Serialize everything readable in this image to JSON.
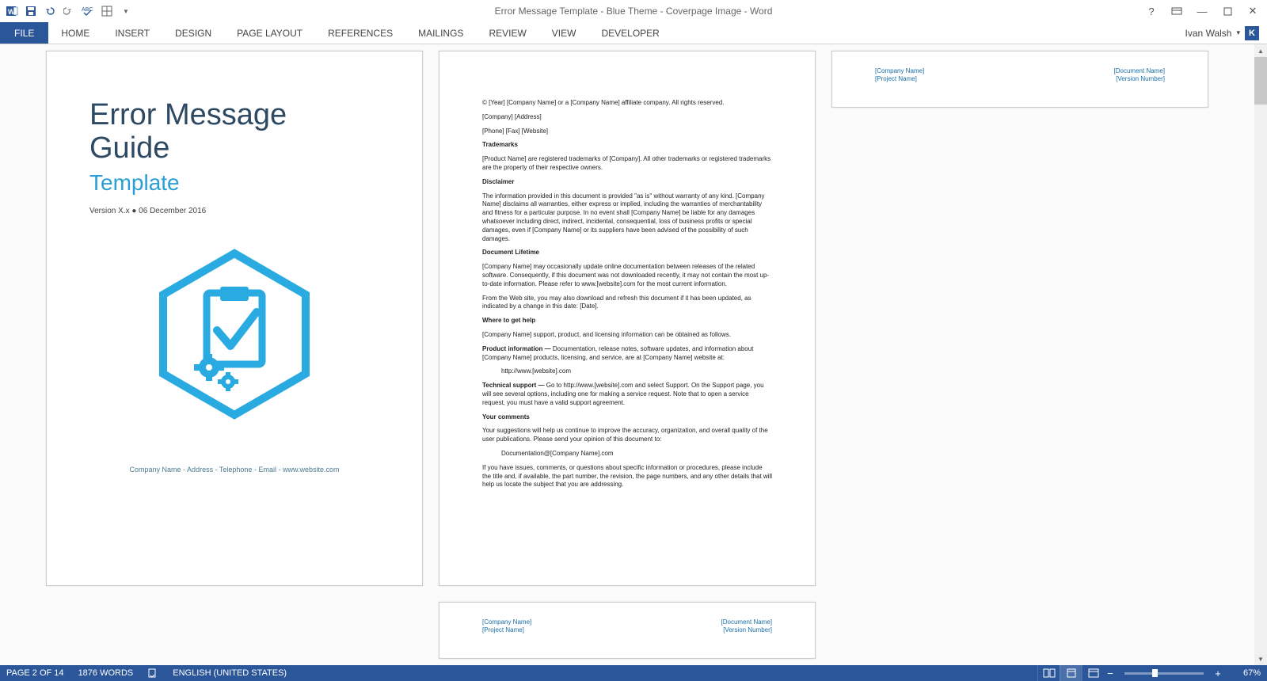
{
  "window": {
    "title": "Error Message Template - Blue Theme - Coverpage Image - Word"
  },
  "user": {
    "name": "Ivan Walsh",
    "dropdown": "▾",
    "badge": "K"
  },
  "ribbon": {
    "file": "FILE",
    "tabs": [
      "HOME",
      "INSERT",
      "DESIGN",
      "PAGE LAYOUT",
      "REFERENCES",
      "MAILINGS",
      "REVIEW",
      "VIEW",
      "DEVELOPER"
    ]
  },
  "cover": {
    "title1": "Error Message",
    "title2": "Guide",
    "subtitle": "Template",
    "version": "Version X.x ● 06 December 2016",
    "footer": "Company Name - Address - Telephone - Email - www.website.com"
  },
  "legal": {
    "copyright": "© [Year] [Company Name] or a [Company Name] affiliate company. All rights reserved.",
    "company_addr": "[Company] [Address]",
    "phone_line": "[Phone] [Fax] [Website]",
    "trademarks_h": "Trademarks",
    "trademarks": "[Product Name] are registered trademarks of [Company]. All other trademarks or registered trademarks are the property of their respective owners.",
    "disclaimer_h": "Disclaimer",
    "disclaimer": "The information provided in this document is provided \"as is\" without warranty of any kind. [Company Name] disclaims all warranties, either express or implied, including the warranties of merchantability and fitness for a particular purpose. In no event shall [Company Name] be liable for any damages whatsoever including direct, indirect, incidental, consequential, loss of business profits or special damages, even if [Company Name] or its suppliers have been advised of the possibility of such damages.",
    "lifetime_h": "Document Lifetime",
    "lifetime1": "[Company Name] may occasionally update online documentation between releases of the related software. Consequently, if this document was not downloaded recently, it may not contain the most up-to-date information. Please refer to www.[website].com for the most current information.",
    "lifetime2": "From the Web site, you may also download and refresh this document if it has been updated, as indicated by a change in this date: [Date].",
    "help_h": "Where to get help",
    "help": "[Company Name] support, product, and licensing information can be obtained as follows.",
    "prodinfo_label": "Product information —",
    "prodinfo": " Documentation, release notes, software updates, and information about [Company Name] products, licensing, and service, are at [Company Name] website at:",
    "prodinfo_url": "http://www.[website].com",
    "tech_label": "Technical support —",
    "tech": " Go to http://www.[website].com and select Support. On the Support page, you will see several options, including one for making a service request. Note that to open a service request, you must have a valid support agreement.",
    "comments_h": "Your comments",
    "comments1": "Your suggestions will help us continue to improve the accuracy, organization, and overall quality of the user publications. Please send your opinion of this document to:",
    "comments_email": "Documentation@[Company Name].com",
    "comments2": "If you have issues, comments, or questions about specific information or procedures, please include the title and, if available, the part number, the revision, the page numbers, and any other details that will help us locate the subject that you are addressing."
  },
  "page_footer": {
    "company": "[Company Name]",
    "project": "[Project Name]",
    "doc": "[Document Name]",
    "ver": "[Version Number]"
  },
  "status": {
    "page": "PAGE 2 OF 14",
    "words": "1876 WORDS",
    "lang": "ENGLISH (UNITED STATES)",
    "zoom": "67%"
  }
}
